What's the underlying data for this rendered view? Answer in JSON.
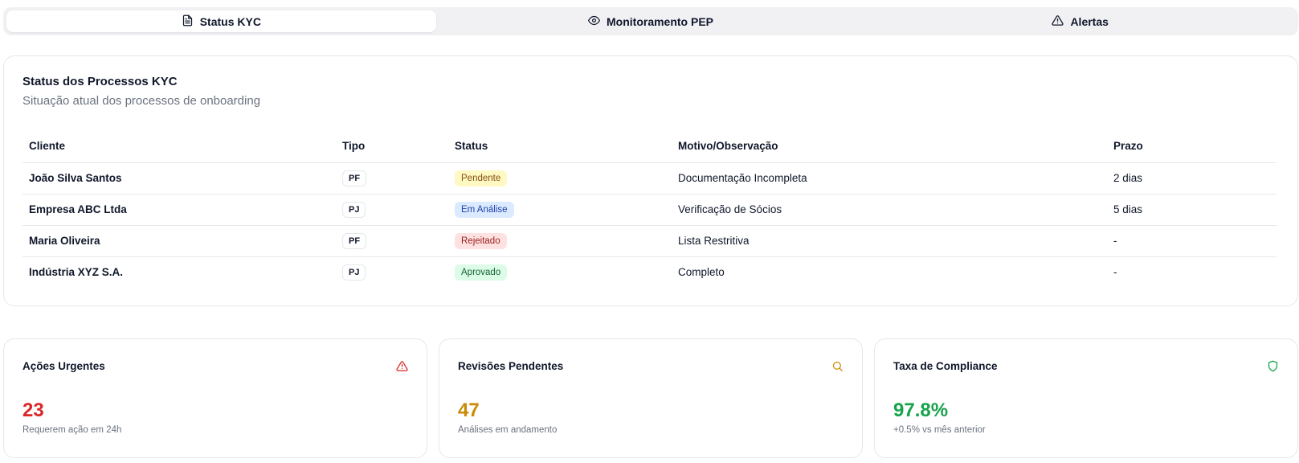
{
  "tabs": [
    {
      "label": "Status KYC",
      "icon": "document-icon",
      "active": true
    },
    {
      "label": "Monitoramento PEP",
      "icon": "eye-icon",
      "active": false
    },
    {
      "label": "Alertas",
      "icon": "warning-triangle-icon",
      "active": false
    }
  ],
  "kyc": {
    "title": "Status dos Processos KYC",
    "subtitle": "Situação atual dos processos de onboarding",
    "columns": [
      "Cliente",
      "Tipo",
      "Status",
      "Motivo/Observação",
      "Prazo"
    ],
    "rows": [
      {
        "client": "João Silva Santos",
        "type": "PF",
        "status": "Pendente",
        "reason": "Documentação Incompleta",
        "deadline": "2 dias"
      },
      {
        "client": "Empresa ABC Ltda",
        "type": "PJ",
        "status": "Em Análise",
        "reason": "Verificação de Sócios",
        "deadline": "5 dias"
      },
      {
        "client": "Maria Oliveira",
        "type": "PF",
        "status": "Rejeitado",
        "reason": "Lista Restritiva",
        "deadline": "-"
      },
      {
        "client": "Indústria XYZ S.A.",
        "type": "PJ",
        "status": "Aprovado",
        "reason": "Completo",
        "deadline": "-"
      }
    ]
  },
  "status_colors": {
    "Pendente": {
      "bg": "#fef9c3",
      "fg": "#854d0e"
    },
    "Em Análise": {
      "bg": "#dbeafe",
      "fg": "#1e40af"
    },
    "Rejeitado": {
      "bg": "#fee2e2",
      "fg": "#991b1b"
    },
    "Aprovado": {
      "bg": "#dcfce7",
      "fg": "#166534"
    }
  },
  "stats": [
    {
      "title": "Ações Urgentes",
      "value": "23",
      "caption": "Requerem ação em 24h",
      "icon": "alert-triangle-icon",
      "color": "#dc2626"
    },
    {
      "title": "Revisões Pendentes",
      "value": "47",
      "caption": "Análises em andamento",
      "icon": "search-icon",
      "color": "#ca8a04"
    },
    {
      "title": "Taxa de Compliance",
      "value": "97.8%",
      "caption": "+0.5% vs mês anterior",
      "icon": "shield-icon",
      "color": "#16a34a"
    }
  ]
}
